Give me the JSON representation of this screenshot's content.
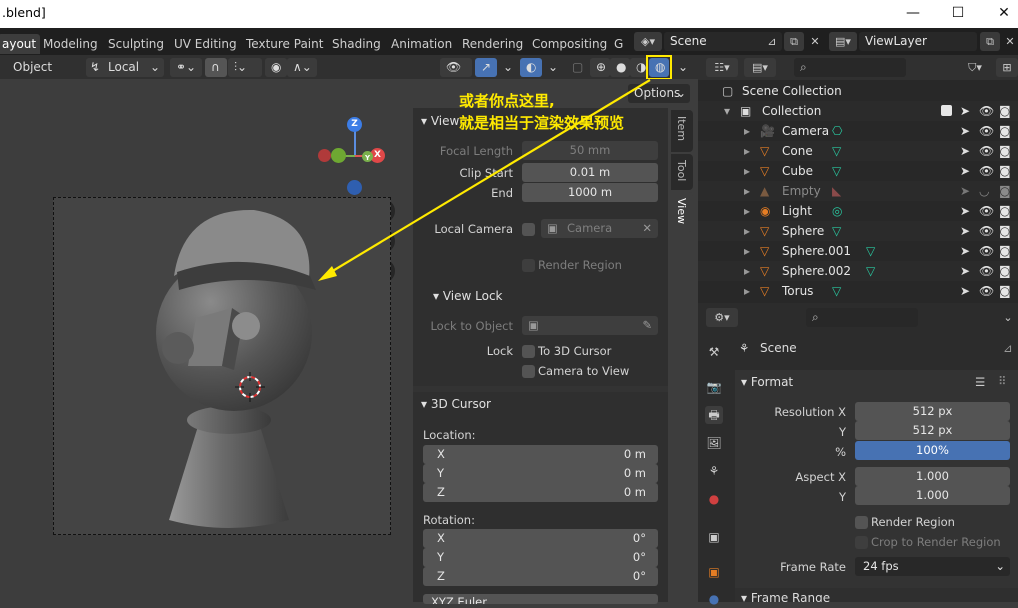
{
  "window": {
    "title": ".blend]",
    "minimize": "—",
    "maximize": "☐",
    "close": "✕"
  },
  "workspace_tabs": [
    "ayout",
    "Modeling",
    "Sculpting",
    "UV Editing",
    "Texture Paint",
    "Shading",
    "Animation",
    "Rendering",
    "Compositing",
    "G"
  ],
  "scene_bar": {
    "scene": "Scene",
    "view_layer": "ViewLayer"
  },
  "header": {
    "mode": "Object",
    "orientation": "Local",
    "options": "Options"
  },
  "annotation": {
    "line1": "或者你点这里,",
    "line2": "就是相当于渲染效果预览"
  },
  "n_panel": {
    "tabs": [
      "Item",
      "Tool",
      "View"
    ],
    "view": {
      "title": "View",
      "focal_length_label": "Focal Length",
      "focal_length": "50 mm",
      "clip_start_label": "Clip Start",
      "clip_start": "0.01 m",
      "end_label": "End",
      "end": "1000 m",
      "local_camera_label": "Local Camera",
      "camera": "Camera",
      "render_region": "Render Region"
    },
    "view_lock": {
      "title": "View Lock",
      "lock_to_object": "Lock to Object",
      "lock_label": "Lock",
      "to_3d_cursor": "To 3D Cursor",
      "camera_to_view": "Camera to View"
    },
    "cursor": {
      "title": "3D Cursor",
      "location_label": "Location:",
      "rotation_label": "Rotation:",
      "location": [
        {
          "axis": "X",
          "value": "0 m"
        },
        {
          "axis": "Y",
          "value": "0 m"
        },
        {
          "axis": "Z",
          "value": "0 m"
        }
      ],
      "rotation": [
        {
          "axis": "X",
          "value": "0°"
        },
        {
          "axis": "Y",
          "value": "0°"
        },
        {
          "axis": "Z",
          "value": "0°"
        }
      ],
      "mode_partial": "XYZ Euler"
    }
  },
  "outliner": {
    "scene_collection": "Scene Collection",
    "collection": "Collection",
    "items": [
      {
        "name": "Camera",
        "icon": "camera-icon",
        "dim": false
      },
      {
        "name": "Cone",
        "icon": "mesh-icon",
        "dim": false
      },
      {
        "name": "Cube",
        "icon": "mesh-icon",
        "dim": false
      },
      {
        "name": "Empty",
        "icon": "empty-icon",
        "dim": true
      },
      {
        "name": "Light",
        "icon": "light-icon",
        "dim": false
      },
      {
        "name": "Sphere",
        "icon": "mesh-icon",
        "dim": false
      },
      {
        "name": "Sphere.001",
        "icon": "mesh-icon",
        "dim": false
      },
      {
        "name": "Sphere.002",
        "icon": "mesh-icon",
        "dim": false
      },
      {
        "name": "Torus",
        "icon": "mesh-icon",
        "dim": false
      }
    ]
  },
  "properties": {
    "context": "Scene",
    "format_title": "Format",
    "resolution_x_label": "Resolution X",
    "resolution_x": "512 px",
    "y_label": "Y",
    "resolution_y": "512 px",
    "percent_label": "%",
    "percent": "100%",
    "aspect_x_label": "Aspect X",
    "aspect_x": "1.000",
    "aspect_y_label": "Y",
    "aspect_y": "1.000",
    "render_region": "Render Region",
    "crop": "Crop to Render Region",
    "frame_rate_label": "Frame Rate",
    "frame_rate": "24 fps",
    "frame_range": "Frame Range"
  },
  "colors": {
    "accent": "#4772b3",
    "highlight": "#ffea00",
    "mesh": "#e57d24",
    "data": "#29c8a0"
  }
}
